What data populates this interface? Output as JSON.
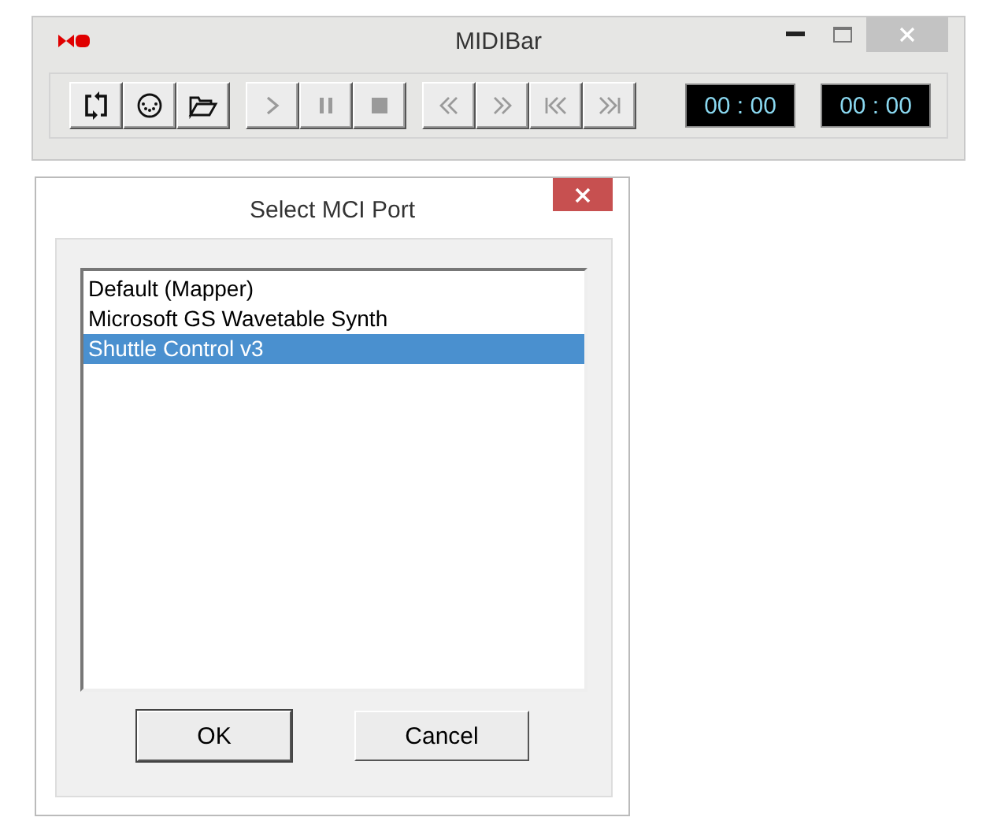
{
  "main_window": {
    "title": "MIDIBar"
  },
  "toolbar": [
    {
      "kind": "loop",
      "disabled": false
    },
    {
      "kind": "port",
      "disabled": false
    },
    {
      "kind": "open",
      "disabled": false
    },
    {
      "kind": "play",
      "disabled": true
    },
    {
      "kind": "pause",
      "disabled": true
    },
    {
      "kind": "stop",
      "disabled": true
    },
    {
      "kind": "rewind",
      "disabled": true
    },
    {
      "kind": "forward",
      "disabled": true
    },
    {
      "kind": "first",
      "disabled": true
    },
    {
      "kind": "last",
      "disabled": true
    }
  ],
  "displays": [
    "00 : 00",
    "00 : 00"
  ],
  "dialog": {
    "title": "Select MCI Port",
    "ports": [
      {
        "label": "Default (Mapper)",
        "selected": false
      },
      {
        "label": "Microsoft GS Wavetable Synth",
        "selected": false
      },
      {
        "label": "Shuttle Control v3",
        "selected": true
      }
    ],
    "buttons": [
      "OK",
      "Cancel"
    ]
  }
}
